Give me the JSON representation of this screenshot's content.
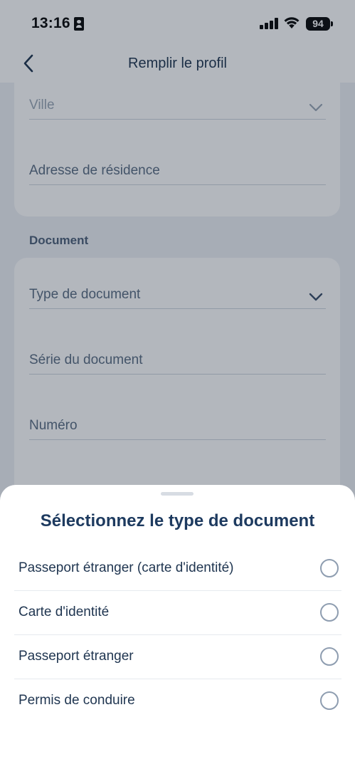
{
  "status_bar": {
    "time": "13:16",
    "battery": "94"
  },
  "header": {
    "title": "Remplir le profil"
  },
  "address_card": {
    "city_label": "Ville",
    "address_label": "Adresse de résidence"
  },
  "document_section": {
    "title": "Document",
    "type_label": "Type de document",
    "series_label": "Série du document",
    "number_label": "Numéro"
  },
  "sheet": {
    "title": "Sélectionnez le type de document",
    "options": [
      {
        "label": "Passeport étranger (carte d'identité)",
        "selected": false
      },
      {
        "label": "Carte d'identité",
        "selected": false
      },
      {
        "label": "Passeport étranger",
        "selected": false
      },
      {
        "label": "Permis de conduire",
        "selected": false
      }
    ]
  },
  "colors": {
    "accent": "#1d3a5f",
    "text": "#1f3550",
    "overlay": "rgba(20,32,50,0.32)"
  }
}
